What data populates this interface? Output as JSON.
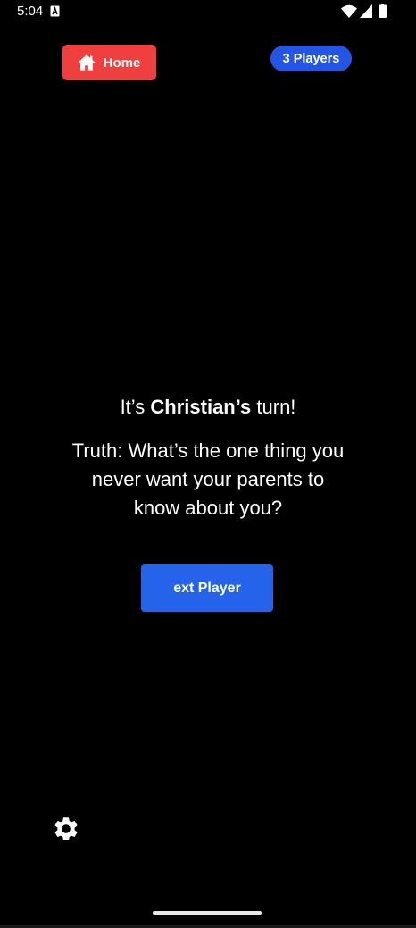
{
  "status_bar": {
    "time": "5:04",
    "icons": [
      "notification-icon",
      "wifi-icon",
      "signal-icon",
      "battery-icon"
    ]
  },
  "header": {
    "home_label": "Home",
    "home_icon": "home-icon",
    "home_color": "#ef3f3f",
    "players_label": "3 Players",
    "players_color": "#2456e6"
  },
  "turn": {
    "prefix": "It’s ",
    "player_name": "Christian’s",
    "suffix": " turn!"
  },
  "question": "Truth: What’s the one thing you never want your parents to know about you?",
  "next_button": {
    "label": "ext Player",
    "color": "#2563eb"
  },
  "settings_icon": "gear-icon",
  "background_color": "#000000"
}
